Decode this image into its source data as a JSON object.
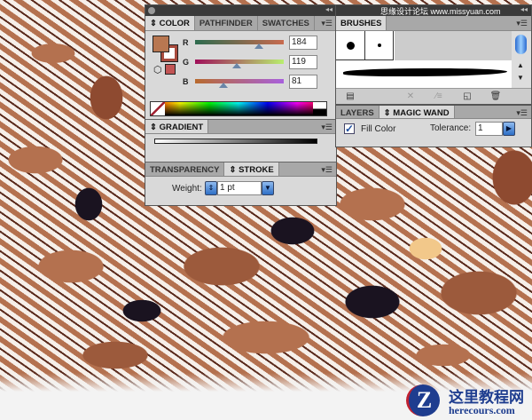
{
  "watermark": "思缘设计论坛 www.missyuan.com",
  "color_panel": {
    "tabs": [
      "COLOR",
      "PATHFINDER",
      "SWATCHES"
    ],
    "channels": [
      {
        "label": "R",
        "value": "184",
        "fraction": 0.72
      },
      {
        "label": "G",
        "value": "119",
        "fraction": 0.47
      },
      {
        "label": "B",
        "value": "81",
        "fraction": 0.32
      }
    ],
    "fill_color": "#b87751",
    "stroke_color": "#a84a3c"
  },
  "gradient_panel": {
    "tab": "GRADIENT"
  },
  "stroke_panel": {
    "tabs": [
      "TRANSPARENCY",
      "STROKE"
    ],
    "weight_label": "Weight:",
    "weight_value": "1 pt"
  },
  "brushes_panel": {
    "tab": "BRUSHES"
  },
  "magic_wand_panel": {
    "tabs": [
      "LAYERS",
      "MAGIC WAND"
    ],
    "fill_color_label": "Fill Color",
    "fill_color_checked": true,
    "tolerance_label": "Tolerance:",
    "tolerance_value": "1"
  },
  "logo": {
    "title": "这里教程网",
    "url": "herecours.com"
  }
}
